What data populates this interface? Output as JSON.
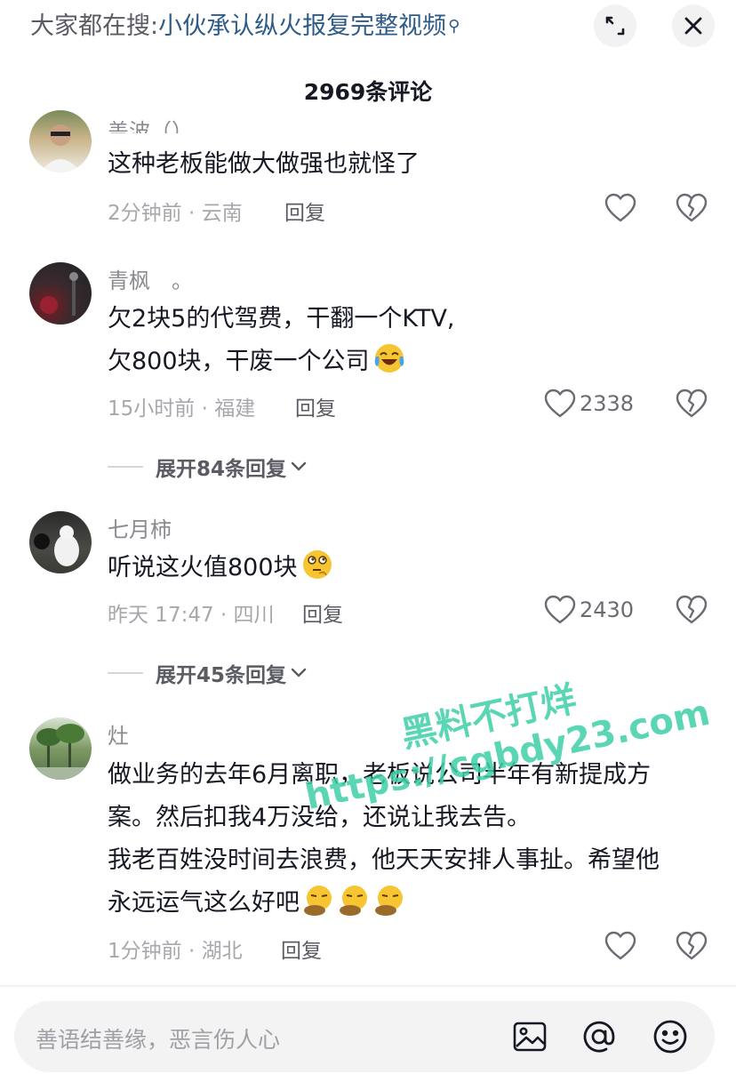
{
  "header": {
    "search_prefix": "大家都在搜:",
    "search_topic": "小伙承认纵火报复完整视频",
    "comment_count": "2969条评论"
  },
  "comments": [
    {
      "name": "盖波（）",
      "lines": [
        "这种老板能做大做强也就怪了"
      ],
      "meta": "2分钟前 · 云南",
      "reply": "回复",
      "likes": ""
    },
    {
      "name": "青枫　。",
      "lines": [
        "欠2块5的代驾费，干翻一个KTV,",
        "欠800块，干废一个公司"
      ],
      "meta": "15小时前 · 福建",
      "reply": "回复",
      "likes": "2338",
      "expand": "展开84条回复"
    },
    {
      "name": "七月柿",
      "lines": [
        "听说这火值800块"
      ],
      "meta": "昨天 17:47 · 四川",
      "reply": "回复",
      "likes": "2430",
      "expand": "展开45条回复"
    },
    {
      "name": "灶",
      "lines": [
        "做业务的去年6月离职，老板说公司半年有新提成方",
        "案。然后扣我4万没给，还说让我去告。",
        "我老百姓没时间去浪费，他天天安排人事扯。希望他",
        "永远运气这么好吧"
      ],
      "meta": "1分钟前 · 湖北",
      "reply": "回复",
      "likes": ""
    }
  ],
  "watermark": {
    "line1": "黑料不打烊",
    "line2": "https://cgbdy23.com"
  },
  "input": {
    "placeholder": "善语结善缘，恶言伤人心"
  },
  "icons": [
    "expand-icon",
    "close-icon",
    "heart-icon",
    "broken-heart-icon",
    "chevron-down-icon",
    "image-icon",
    "at-icon",
    "smiley-icon"
  ]
}
